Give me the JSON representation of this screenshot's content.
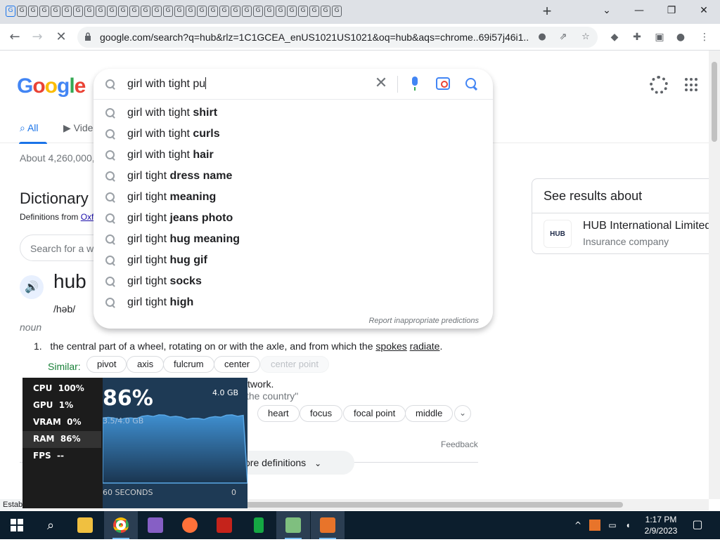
{
  "browser": {
    "tab_favicon_glyph": "G",
    "tab_count": 30,
    "new_tab_label": "+",
    "window_controls": {
      "dropdown": "⌄",
      "minimize": "—",
      "maximize": "❐",
      "close": "✕"
    },
    "nav": {
      "back": "←",
      "forward": "→",
      "reload": "✕"
    },
    "url": "google.com/search?q=hub&rlz=1C1GCEA_enUS1021US1021&oq=hub&aqs=chrome..69i57j46i1..."
  },
  "google": {
    "logo_letters": [
      "G",
      "o",
      "o",
      "g",
      "l",
      "e"
    ],
    "tabs": [
      {
        "label": "All",
        "icon": "search-icon"
      },
      {
        "label": "Vide",
        "icon": "video-icon"
      }
    ],
    "result_stats": "About 4,260,000,",
    "dictionary": {
      "title": "Dictionary",
      "definitions_from": "Definitions from",
      "source": "Oxf",
      "search_placeholder": "Search for a w",
      "word": "hub",
      "pronunciation": "/həb/",
      "part_of_speech": "noun",
      "definition_1": {
        "number": "1.",
        "text_before": "the central part of a wheel, rotating on or with the axle, and from which the",
        "link_1": "spokes",
        "link_2": "radiate",
        "text_after": "."
      },
      "similar_label": "Similar:",
      "similar_1": [
        "pivot",
        "axis",
        "fulcrum",
        "center",
        "center point"
      ],
      "definition_2_fragment": "twork.",
      "definition_2_example": "the country\"",
      "similar_2": [
        "heart",
        "focus",
        "focal point",
        "middle"
      ],
      "feedback": "Feedback",
      "more_definitions": "ore definitions"
    },
    "knowledge_panel": {
      "title": "See results about",
      "logo_text": "HUB",
      "entity_name": "HUB International Limited",
      "entity_type": "Insurance company"
    },
    "autocomplete": {
      "query": "girl with tight pu",
      "suggestions": [
        {
          "prefix": "girl with tight ",
          "bold": "shirt"
        },
        {
          "prefix": "girl with tight ",
          "bold": "curls"
        },
        {
          "prefix": "girl with tight ",
          "bold": "hair"
        },
        {
          "prefix": "girl tight ",
          "bold": "dress name"
        },
        {
          "prefix": "girl tight ",
          "bold": "meaning"
        },
        {
          "prefix": "girl tight ",
          "bold": "jeans photo"
        },
        {
          "prefix": "girl tight ",
          "bold": "hug meaning"
        },
        {
          "prefix": "girl tight ",
          "bold": "hug gif"
        },
        {
          "prefix": "girl tight ",
          "bold": "socks"
        },
        {
          "prefix": "girl tight ",
          "bold": "high"
        }
      ],
      "report_link": "Report inappropriate predictions"
    }
  },
  "status_bar_text": "Estab",
  "performance_overlay": {
    "rows": [
      {
        "label": "CPU",
        "value": "100%"
      },
      {
        "label": "GPU",
        "value": "1%"
      },
      {
        "label": "VRAM",
        "value": "0%"
      },
      {
        "label": "RAM",
        "value": "86%"
      },
      {
        "label": "FPS",
        "value": "--"
      }
    ],
    "selected_metric": "RAM",
    "big_value": "86%",
    "capacity": "4.0 GB",
    "used": "3.5/4.0 GB",
    "window_label": "60 SECONDS",
    "min_label": "0"
  },
  "taskbar": {
    "apps": [
      "windows-start",
      "search",
      "file-explorer",
      "chrome",
      "visual-studio",
      "firefox",
      "game-app",
      "green-app",
      "image-app",
      "rocket-app"
    ],
    "active_app": "chrome",
    "time": "1:17 PM",
    "date": "2/9/2023",
    "tray_chevron": "^",
    "colors": {
      "taskbar": "#0c1e2d",
      "accent": "#76b9ed"
    }
  },
  "colors": {
    "link": "#1a0dab",
    "google_blue": "#4285f4",
    "tab_active": "#1a73e8",
    "similar_green": "#188038"
  }
}
